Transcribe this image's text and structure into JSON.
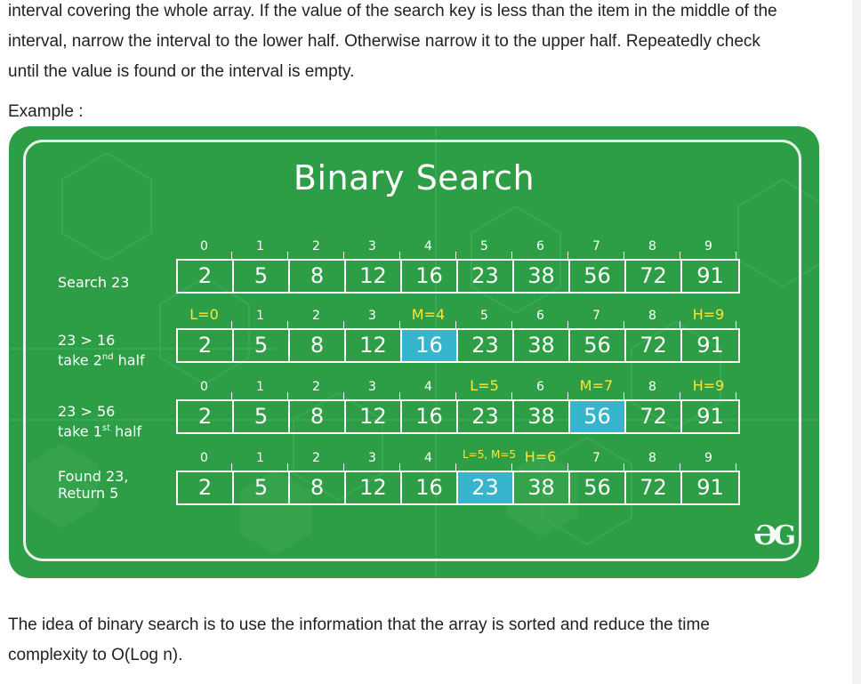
{
  "text": {
    "intro_lines": [
      "interval covering the whole array. If the value of the search key is less than the item in the middle of the",
      "interval, narrow the interval to the lower half. Otherwise narrow it to the upper half. Repeatedly check",
      "until the value is found or the interval is empty."
    ],
    "example_label": "Example :",
    "outro_lines": [
      "The idea of binary search is to use the information that the array is sorted and reduce the time",
      "complexity to O(Log n)."
    ]
  },
  "illustration": {
    "title": "Binary Search",
    "logo": "ƏG",
    "colors": {
      "background": "#2e9e46",
      "highlight": "#36b5cc",
      "marker": "#ffe437"
    },
    "steps": [
      {
        "label_lines": [
          "Search 23"
        ],
        "indices": [
          "0",
          "1",
          "2",
          "3",
          "4",
          "5",
          "6",
          "7",
          "8",
          "9"
        ],
        "markers": {},
        "values": [
          "2",
          "5",
          "8",
          "12",
          "16",
          "23",
          "38",
          "56",
          "72",
          "91"
        ],
        "highlight": -1
      },
      {
        "label_lines": [
          "23 > 16",
          "take 2",
          "nd",
          " half"
        ],
        "indices": [
          "L=0",
          "1",
          "2",
          "3",
          "M=4",
          "5",
          "6",
          "7",
          "8",
          "H=9"
        ],
        "markers": {
          "0": true,
          "4": true,
          "9": true
        },
        "values": [
          "2",
          "5",
          "8",
          "12",
          "16",
          "23",
          "38",
          "56",
          "72",
          "91"
        ],
        "highlight": 4
      },
      {
        "label_lines": [
          "23 > 56",
          "take 1",
          "st",
          " half"
        ],
        "indices": [
          "0",
          "1",
          "2",
          "3",
          "4",
          "L=5",
          "6",
          "M=7",
          "8",
          "H=9"
        ],
        "markers": {
          "5": true,
          "7": true,
          "9": true
        },
        "values": [
          "2",
          "5",
          "8",
          "12",
          "16",
          "23",
          "38",
          "56",
          "72",
          "91"
        ],
        "highlight": 7
      },
      {
        "label_lines": [
          "Found 23,",
          "Return 5"
        ],
        "indices": [
          "0",
          "1",
          "2",
          "3",
          "4",
          "L=5, M=5",
          "H=6",
          "7",
          "8",
          "9"
        ],
        "markers": {
          "5": true,
          "6": true
        },
        "values": [
          "2",
          "5",
          "8",
          "12",
          "16",
          "23",
          "38",
          "56",
          "72",
          "91"
        ],
        "highlight": 5
      }
    ]
  }
}
